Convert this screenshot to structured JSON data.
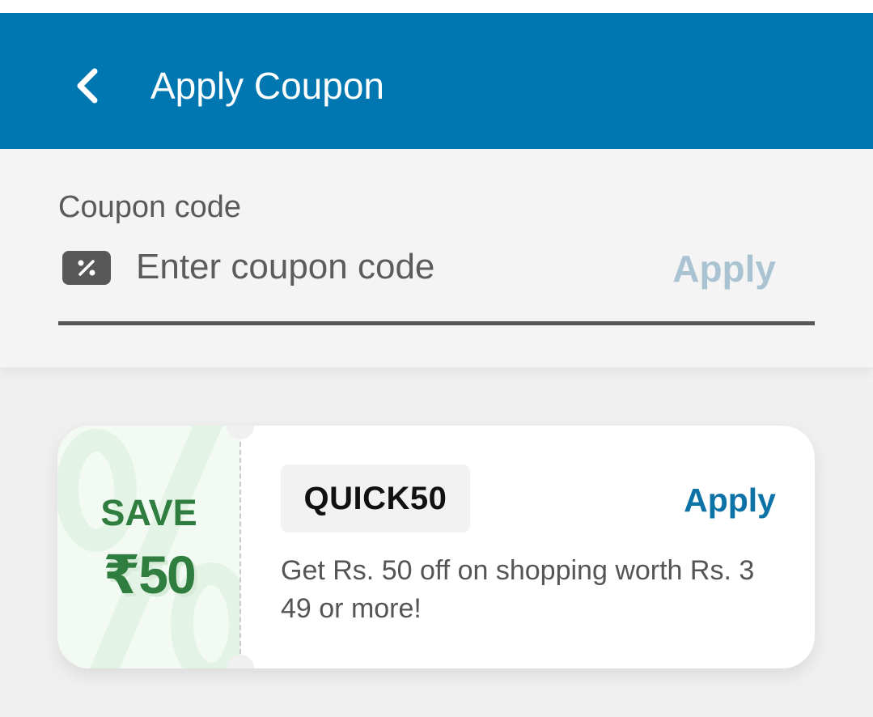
{
  "app_bar": {
    "title": "Apply Coupon",
    "back_icon": "chevron-left-icon",
    "background_color": "#0077b0"
  },
  "coupon_form": {
    "label": "Coupon code",
    "placeholder": "Enter coupon code",
    "value": "",
    "icon": "coupon-percent-icon",
    "apply_label": "Apply",
    "apply_enabled": false
  },
  "coupons": [
    {
      "save_label": "SAVE",
      "amount": "₹50",
      "code": "QUICK50",
      "apply_label": "Apply",
      "description": "Get Rs. 50 off on shopping worth Rs. 349 or more!",
      "accent_color": "#2f7d3f",
      "watermark_icon": "percent-icon"
    }
  ]
}
